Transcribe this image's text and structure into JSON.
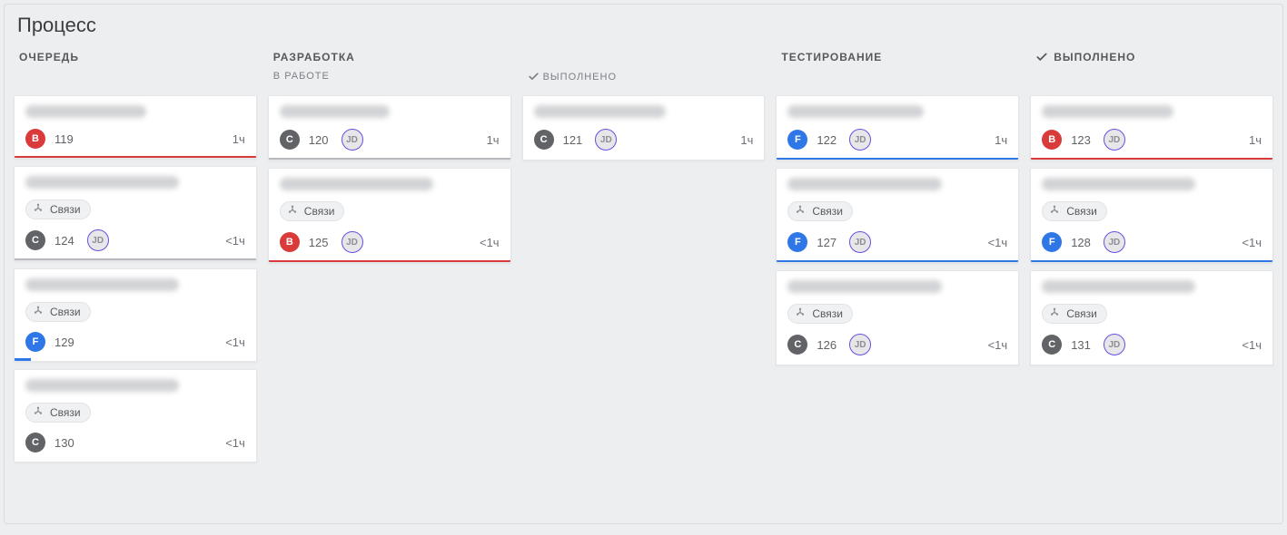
{
  "title": "Процесс",
  "link_label": "Связи",
  "avatar_initials": "JD",
  "type_letters": {
    "B": "B",
    "C": "C",
    "F": "F"
  },
  "columns": {
    "queue": {
      "title": "ОЧЕРЕДЬ"
    },
    "dev": {
      "title": "РАЗРАБОТКА",
      "sub": "В РАБОТЕ"
    },
    "devdone": {
      "sub": "ВЫПОЛНЕНО"
    },
    "test": {
      "title": "ТЕСТИРОВАНИЕ"
    },
    "done": {
      "title": "ВЫПОЛНЕНО"
    }
  },
  "cards": {
    "c119": {
      "id": "119",
      "est": "1ч",
      "type": "B"
    },
    "c120": {
      "id": "120",
      "est": "1ч",
      "type": "C"
    },
    "c121": {
      "id": "121",
      "est": "1ч",
      "type": "C"
    },
    "c122": {
      "id": "122",
      "est": "1ч",
      "type": "F"
    },
    "c123": {
      "id": "123",
      "est": "1ч",
      "type": "B"
    },
    "c124": {
      "id": "124",
      "est": "<1ч",
      "type": "C"
    },
    "c125": {
      "id": "125",
      "est": "<1ч",
      "type": "B"
    },
    "c127": {
      "id": "127",
      "est": "<1ч",
      "type": "F"
    },
    "c128": {
      "id": "128",
      "est": "<1ч",
      "type": "F"
    },
    "c129": {
      "id": "129",
      "est": "<1ч",
      "type": "F"
    },
    "c126": {
      "id": "126",
      "est": "<1ч",
      "type": "C"
    },
    "c131": {
      "id": "131",
      "est": "<1ч",
      "type": "C"
    },
    "c130": {
      "id": "130",
      "est": "<1ч",
      "type": "C"
    }
  }
}
